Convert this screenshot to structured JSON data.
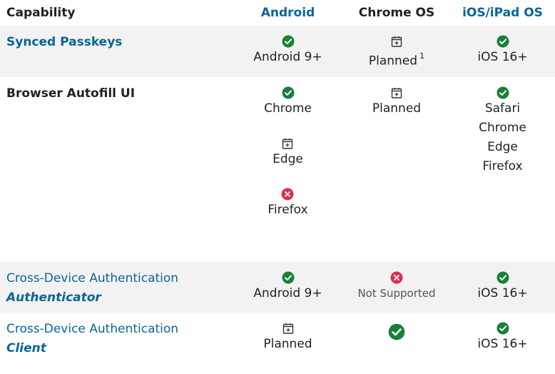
{
  "header": {
    "capability": "Capability",
    "android": "Android",
    "chromeos": "Chrome OS",
    "ios": "iOS/iPad OS"
  },
  "rows": [
    {
      "title": "Synced Passkeys",
      "android": {
        "icon": "check-icon",
        "label": "Android 9+"
      },
      "chromeos": {
        "icon": "calendar-plus-icon",
        "label": "Planned",
        "footnote": "1"
      },
      "ios": {
        "icon": "check-icon",
        "label": "iOS 16+"
      }
    },
    {
      "title": "Browser Autofill UI",
      "android": [
        {
          "icon": "check-icon",
          "label": "Chrome"
        },
        {
          "icon": "calendar-plus-icon",
          "label": "Edge"
        },
        {
          "icon": "x-circle-icon",
          "label": "Firefox"
        }
      ],
      "chromeos": {
        "icon": "calendar-plus-icon",
        "label": "Planned"
      },
      "ios": {
        "icon": "check-icon",
        "labels": [
          "Safari",
          "Chrome",
          "Edge",
          "Firefox"
        ]
      }
    },
    {
      "title_line1": "Cross-Device Authentication",
      "title_line2": "Authenticator",
      "android": {
        "icon": "check-icon",
        "label": "Android 9+"
      },
      "chromeos": {
        "icon": "x-circle-icon",
        "label": "Not Supported"
      },
      "ios": {
        "icon": "check-icon",
        "label": "iOS 16+"
      }
    },
    {
      "title_line1": "Cross-Device Authentication",
      "title_line2": "Client",
      "android": {
        "icon": "calendar-plus-icon",
        "label": "Planned"
      },
      "chromeos": {
        "icon": "check-icon-large"
      },
      "ios": {
        "icon": "check-icon",
        "label": "iOS 16+"
      }
    }
  ],
  "colors": {
    "link_blue": "#0a6496",
    "check_green": "#188038",
    "x_red": "#d93050",
    "row_shade": "#f2f2f2"
  }
}
